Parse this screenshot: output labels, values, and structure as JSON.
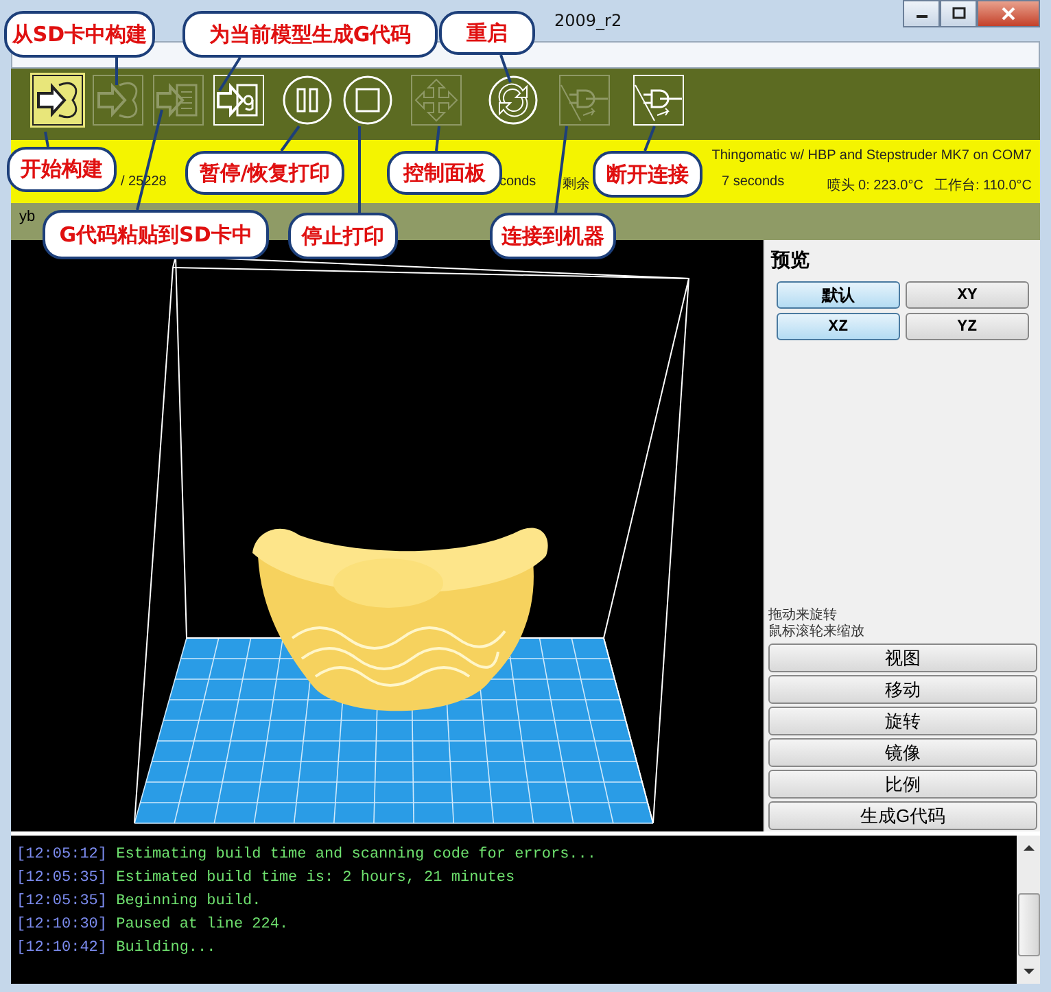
{
  "window": {
    "title_fragment": "2009_r2"
  },
  "toolbar": [
    {
      "kind": "build",
      "selected": true,
      "disabled": false
    },
    {
      "kind": "sd-build",
      "selected": false,
      "disabled": true
    },
    {
      "kind": "sd-upload",
      "selected": false,
      "disabled": true
    },
    {
      "kind": "gcode",
      "selected": false,
      "disabled": false
    },
    {
      "kind": "pause",
      "selected": false,
      "disabled": false
    },
    {
      "kind": "stop",
      "selected": false,
      "disabled": false
    },
    {
      "kind": "control",
      "selected": false,
      "disabled": true
    },
    {
      "kind": "reset",
      "selected": false,
      "disabled": false
    },
    {
      "kind": "connect",
      "selected": false,
      "disabled": true
    },
    {
      "kind": "disconnect",
      "selected": false,
      "disabled": false
    }
  ],
  "status_bar": {
    "fragments": [
      "/ 25228",
      "conds",
      "剩余",
      "7 seconds"
    ],
    "machine": "Thingomatic w/ HBP and Stepstruder MK7 on COM7",
    "nozzle": "喷头 0: 223.0°C",
    "platform": "工作台: 110.0°C"
  },
  "tab_row": {
    "fragment": "yb"
  },
  "preview": {
    "title": "预览",
    "views": [
      {
        "label": "默认",
        "selected": true
      },
      {
        "label": "XY",
        "selected": false
      },
      {
        "label": "XZ",
        "selected": true
      },
      {
        "label": "YZ",
        "selected": false
      }
    ],
    "hints": [
      "拖动来旋转",
      "鼠标滚轮来缩放"
    ],
    "buttons": [
      "视图",
      "移动",
      "旋转",
      "镜像",
      "比例",
      "生成G代码"
    ]
  },
  "console": [
    {
      "time": "[12:05:12]",
      "message": "Estimating build time and scanning code for errors..."
    },
    {
      "time": "[12:05:35]",
      "message": "Estimated build time is: 2 hours, 21 minutes"
    },
    {
      "time": "[12:05:35]",
      "message": "Beginning build."
    },
    {
      "time": "[12:10:30]",
      "message": "Paused at line 224."
    },
    {
      "time": "[12:10:42]",
      "message": "Building..."
    }
  ],
  "callouts": [
    "从SD卡中构建",
    "为当前模型生成G代码",
    "重启",
    "开始构建",
    "暂停/恢复打印",
    "控制面板",
    "断开连接",
    "G代码粘贴到SD卡中",
    "停止打印",
    "连接到机器"
  ]
}
